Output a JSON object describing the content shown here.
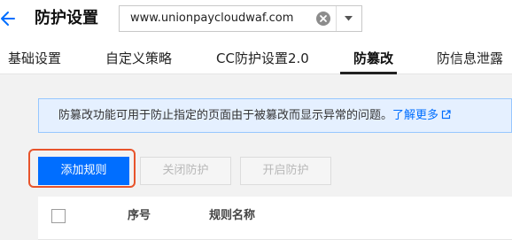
{
  "header": {
    "title": "防护设置",
    "domain_value": "www.unionpaycloudwaf.com",
    "back_icon": "arrow-left-icon",
    "clear_icon": "clear-circle-icon",
    "dropdown_icon": "chevron-down-icon"
  },
  "tabs": [
    {
      "label": "基础设置",
      "active": false
    },
    {
      "label": "自定义策略",
      "active": false
    },
    {
      "label": "CC防护设置2.0",
      "active": false
    },
    {
      "label": "防篡改",
      "active": true
    },
    {
      "label": "防信息泄露",
      "active": false
    }
  ],
  "notice": {
    "text": "防篡改功能可用于防止指定的页面由于被篡改而显示异常的问题。",
    "link": "了解更多",
    "link_icon": "external-link-icon"
  },
  "toolbar": {
    "add_rule": "添加规则",
    "disable_protection": "关闭防护",
    "enable_protection": "开启防护"
  },
  "table": {
    "columns": [
      "序号",
      "规则名称"
    ]
  },
  "colors": {
    "primary": "#006eff",
    "highlight": "#e8542b",
    "notice_bg": "#e5f0ff",
    "notice_border": "#97c7ff"
  }
}
